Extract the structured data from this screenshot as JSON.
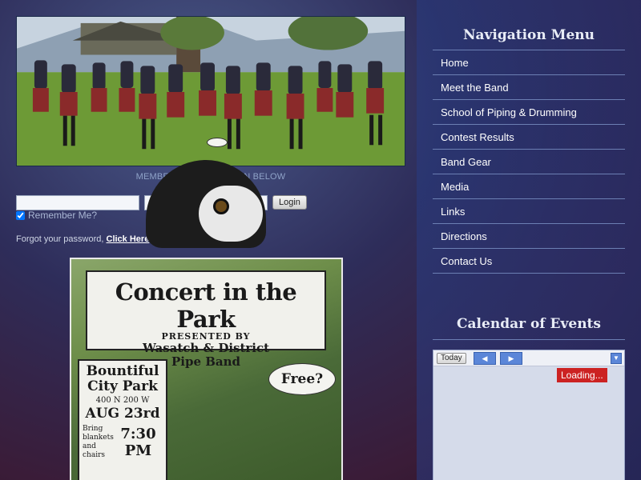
{
  "login": {
    "caption": "MEMBERS PLEASE LOGIN BELOW",
    "username_value": "",
    "password_value": "",
    "login_label": "Login",
    "remember_label": "Remember Me?",
    "forgot_text": "Forgot your password,",
    "forgot_link": "Click Here"
  },
  "poster": {
    "title": "Concert in the Park",
    "presented": "PRESENTED BY",
    "band_line1": "Wasatch & District",
    "band_line2": "Pipe Band",
    "park_line1": "Bountiful",
    "park_line2": "City Park",
    "address": "400 N 200 W",
    "date": "AUG 23rd",
    "bring_line1": "Bring",
    "bring_line2": "blankets",
    "bring_line3": "and chairs",
    "time": "7:30 PM",
    "bubble": "Free?"
  },
  "nav": {
    "title": "Navigation Menu",
    "items": [
      {
        "label": "Home"
      },
      {
        "label": "Meet the Band"
      },
      {
        "label": "School of Piping & Drumming"
      },
      {
        "label": "Contest Results"
      },
      {
        "label": "Band Gear"
      },
      {
        "label": "Media"
      },
      {
        "label": "Links"
      },
      {
        "label": "Directions"
      },
      {
        "label": "Contact Us"
      }
    ]
  },
  "calendar": {
    "title": "Calendar of Events",
    "today_label": "Today",
    "prev_icon": "triangle-left-icon",
    "next_icon": "triangle-right-icon",
    "loading_text": "Loading..."
  },
  "colors": {
    "link": "#ffffff",
    "loading_bg": "#cc2222",
    "cal_button": "#5b86d8"
  }
}
